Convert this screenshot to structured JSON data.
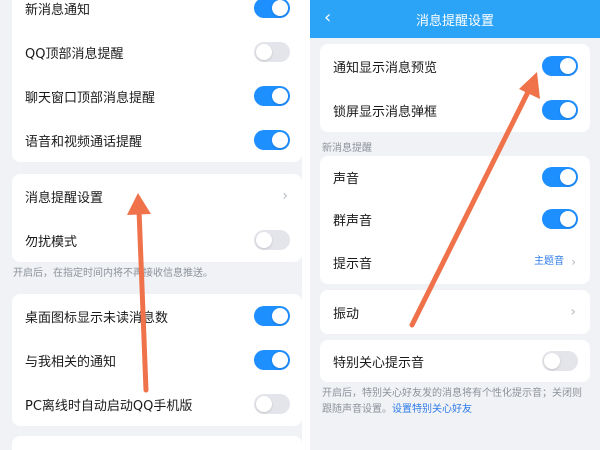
{
  "colors": {
    "accent": "#1e8fff",
    "header": "#2ba3f7",
    "annotation_arrow": "#f0724a"
  },
  "left": {
    "group1": [
      {
        "label": "新消息通知",
        "toggle": true
      },
      {
        "label": "QQ顶部消息提醒",
        "toggle": false
      },
      {
        "label": "聊天窗口顶部消息提醒",
        "toggle": true
      },
      {
        "label": "语音和视频通话提醒",
        "toggle": true
      }
    ],
    "message_settings": {
      "label": "消息提醒设置"
    },
    "dnd": {
      "label": "勿扰模式",
      "toggle": false
    },
    "dnd_note": "开启后，在指定时间内将不再接收信息推送。",
    "group3": [
      {
        "label": "桌面图标显示未读消息数",
        "toggle": true
      },
      {
        "label": "与我相关的通知",
        "toggle": true
      },
      {
        "label": "PC离线时自动启动QQ手机版",
        "toggle": false
      }
    ]
  },
  "right": {
    "header": {
      "back_icon": "chevron-left-icon",
      "title": "消息提醒设置"
    },
    "group1": [
      {
        "label": "通知显示消息预览",
        "toggle": true
      },
      {
        "label": "锁屏显示消息弹框",
        "toggle": true
      }
    ],
    "section_label": "新消息提醒",
    "group2": [
      {
        "label": "声音",
        "toggle": true
      },
      {
        "label": "群声音",
        "toggle": true
      }
    ],
    "tone": {
      "label": "提示音",
      "value": "主题音"
    },
    "vibration": {
      "label": "振动"
    },
    "special": {
      "label": "特别关心提示音",
      "toggle": false
    },
    "special_note_1": "开启后，特别关心好友发的消息将有个性化提示音；关闭则",
    "special_note_2": "跟随声音设置。",
    "special_note_link": "设置特别关心好友"
  }
}
